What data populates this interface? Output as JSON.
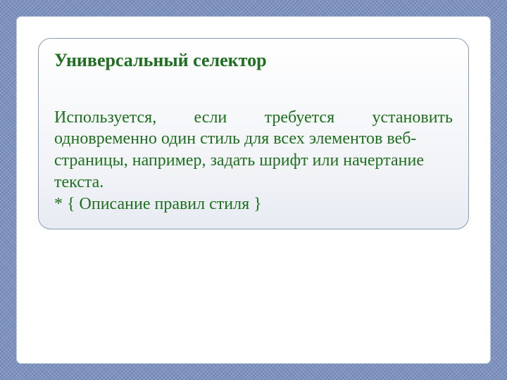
{
  "card": {
    "title": "Универсальный селектор",
    "line1": "Используется, если требуется установить",
    "rest": "одновременно один стиль для всех элементов веб-страницы, например, задать шрифт или начертание текста.\n* { Описание правил стиля }"
  }
}
